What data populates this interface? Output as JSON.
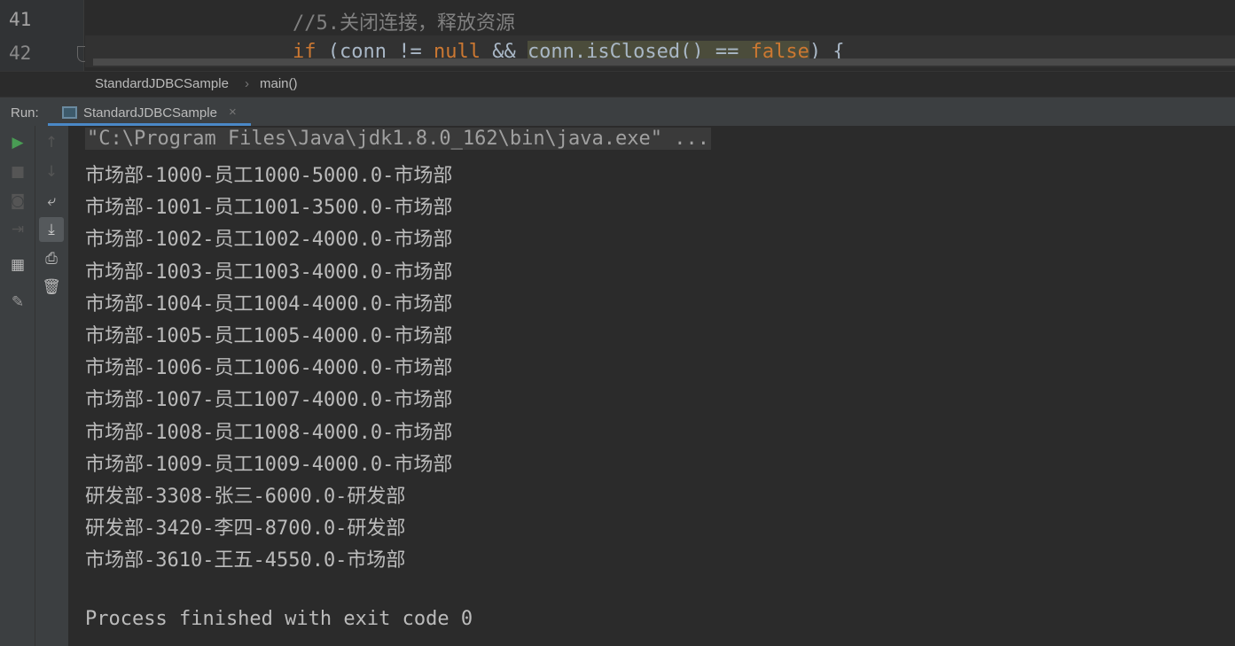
{
  "editor": {
    "line_numbers": [
      "41",
      "42"
    ],
    "line41": "//5.关闭连接，释放资源",
    "line42": {
      "if": "if",
      "open": " (",
      "conn1": "conn",
      "neq": " != ",
      "null": "null",
      "and": " && ",
      "conn2": "conn",
      "call": ".isClosed() == ",
      "false": "false",
      "close": ") {"
    }
  },
  "breadcrumb": {
    "class": "StandardJDBCSample",
    "sep": "›",
    "method": "main()"
  },
  "run": {
    "label": "Run:",
    "tab": "StandardJDBCSample",
    "close": "×"
  },
  "toolbar": {
    "left": [
      "run-icon",
      "stop-icon",
      "camera-icon",
      "login-icon",
      "layout-icon",
      "pin-icon"
    ],
    "right": [
      "up-icon",
      "down-icon",
      "wrap-icon",
      "scroll-end-icon",
      "print-icon",
      "trash-icon"
    ]
  },
  "console": {
    "command": "\"C:\\Program Files\\Java\\jdk1.8.0_162\\bin\\java.exe\" ...",
    "lines": [
      "市场部-1000-员工1000-5000.0-市场部",
      "市场部-1001-员工1001-3500.0-市场部",
      "市场部-1002-员工1002-4000.0-市场部",
      "市场部-1003-员工1003-4000.0-市场部",
      "市场部-1004-员工1004-4000.0-市场部",
      "市场部-1005-员工1005-4000.0-市场部",
      "市场部-1006-员工1006-4000.0-市场部",
      "市场部-1007-员工1007-4000.0-市场部",
      "市场部-1008-员工1008-4000.0-市场部",
      "市场部-1009-员工1009-4000.0-市场部",
      "研发部-3308-张三-6000.0-研发部",
      "研发部-3420-李四-8700.0-研发部",
      "市场部-3610-王五-4550.0-市场部"
    ],
    "finish": "Process finished with exit code 0"
  }
}
